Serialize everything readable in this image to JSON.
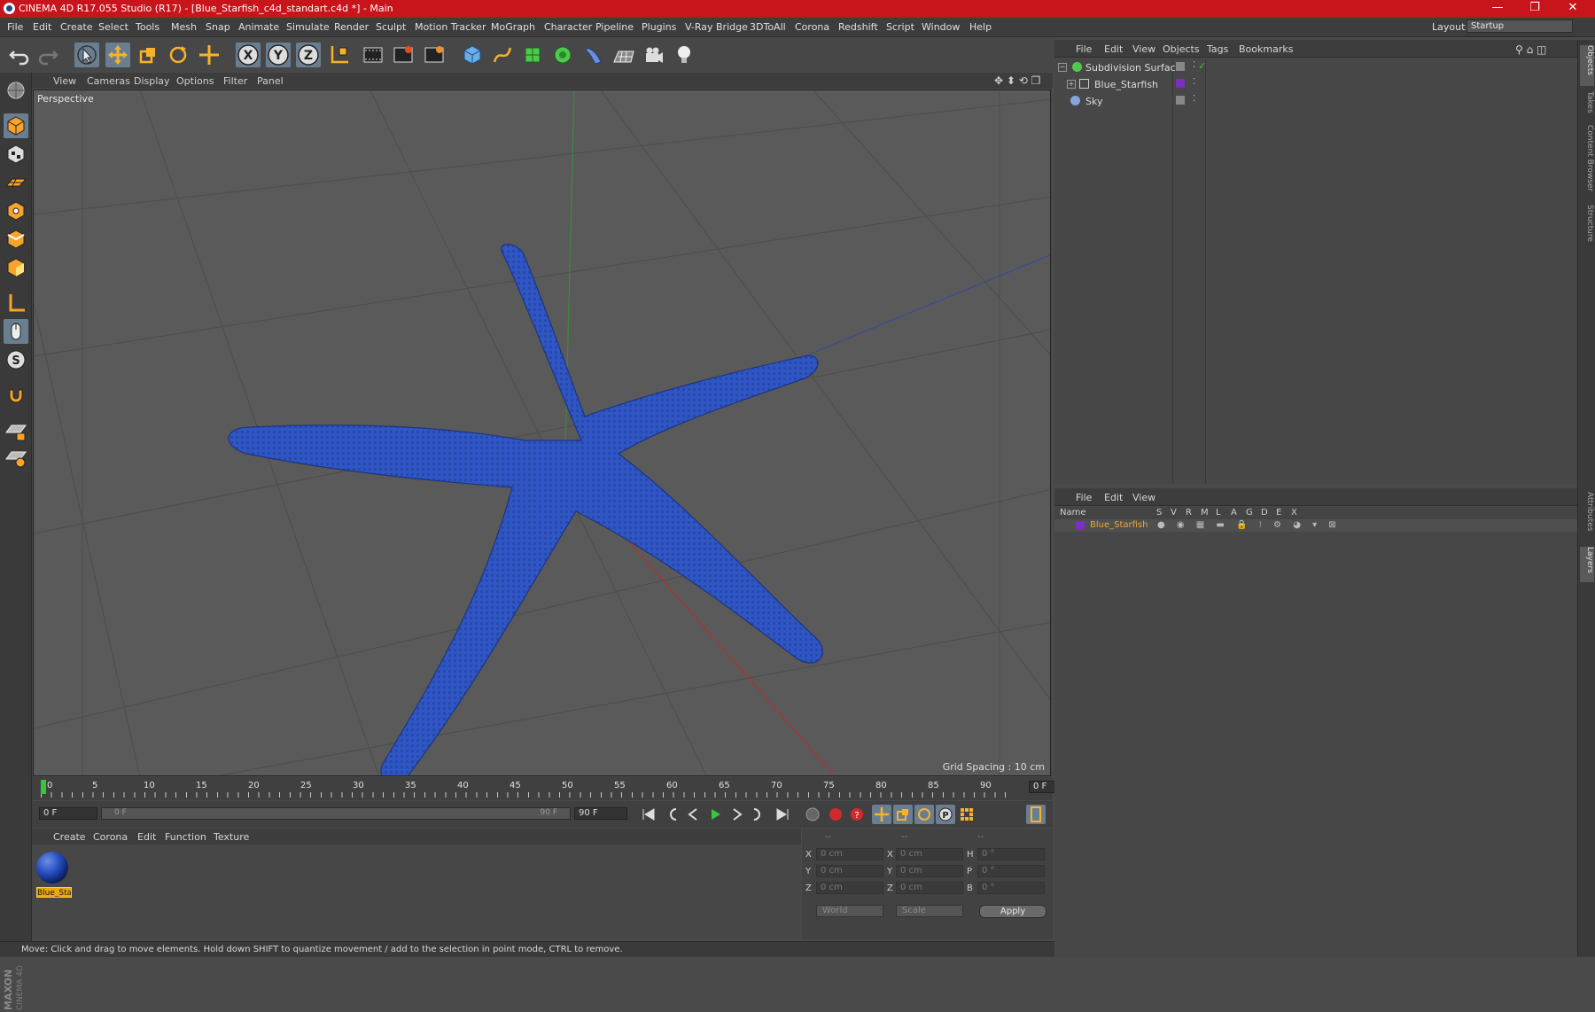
{
  "window": {
    "title": "CINEMA 4D R17.055 Studio (R17) - [Blue_Starfish_c4d_standart.c4d *] - Main",
    "controls": [
      "—",
      "❐",
      "✕"
    ]
  },
  "menubar": {
    "items": [
      "File",
      "Edit",
      "Create",
      "Select",
      "Tools",
      "Mesh",
      "Snap",
      "Animate",
      "Simulate",
      "Render",
      "Sculpt",
      "Motion Tracker",
      "MoGraph",
      "Character",
      "Pipeline",
      "Plugins",
      "V-Ray Bridge",
      "3DToAll",
      "Corona",
      "Redshift",
      "Script",
      "Window",
      "Help"
    ],
    "layout_label": "Layout:",
    "layout_value": "Startup"
  },
  "toolbar": {
    "icons": [
      "undo-icon",
      "redo-icon",
      "live-selection-icon",
      "move-icon",
      "scale-icon",
      "rotate-icon",
      "recent-tool-icon",
      "x-axis-lock-icon",
      "y-axis-lock-icon",
      "z-axis-lock-icon",
      "world-coordinate-icon",
      "render-view-icon",
      "render-picture-viewer-icon",
      "edit-render-settings-icon",
      "cube-primitive-icon",
      "pen-spline-icon",
      "subdivision-surface-icon",
      "cloner-icon",
      "deformer-icon",
      "floor-icon",
      "camera-icon",
      "light-icon"
    ],
    "x_label": "X",
    "y_label": "Y",
    "z_label": "Z"
  },
  "viewport": {
    "menu": [
      "View",
      "Cameras",
      "Display",
      "Options",
      "Filter",
      "Panel"
    ],
    "label": "Perspective",
    "grid_spacing": "Grid Spacing : 10 cm",
    "object_color": "#2f56c4"
  },
  "timeline": {
    "ticks": [
      "0",
      "5",
      "10",
      "15",
      "20",
      "25",
      "30",
      "35",
      "40",
      "45",
      "50",
      "55",
      "60",
      "65",
      "70",
      "75",
      "80",
      "85",
      "90"
    ],
    "current_frame": "0 F",
    "start_field": "0 F",
    "range_start": "0 F",
    "range_end": "90 F",
    "end_field": "90 F"
  },
  "material_manager": {
    "menu": [
      "Create",
      "Corona",
      "Edit",
      "Function",
      "Texture"
    ],
    "materials": [
      {
        "name": "Blue_Sta"
      }
    ]
  },
  "coordinates": {
    "header": [
      "--",
      "--",
      "--"
    ],
    "rows": [
      {
        "axis": "X",
        "pos": "0 cm",
        "size_axis": "X",
        "size": "0 cm",
        "rot_axis": "H",
        "rot": "0 °"
      },
      {
        "axis": "Y",
        "pos": "0 cm",
        "size_axis": "Y",
        "size": "0 cm",
        "rot_axis": "P",
        "rot": "0 °"
      },
      {
        "axis": "Z",
        "pos": "0 cm",
        "size_axis": "Z",
        "size": "0 cm",
        "rot_axis": "B",
        "rot": "0 °"
      }
    ],
    "space_dropdown": "World",
    "mode_dropdown": "Scale",
    "apply_label": "Apply"
  },
  "object_manager": {
    "menu": [
      "File",
      "Edit",
      "View",
      "Objects",
      "Tags",
      "Bookmarks"
    ],
    "objects": [
      {
        "name": "Subdivision Surface",
        "icon": "subdivision-surface-icon"
      },
      {
        "name": "Blue_Starfish",
        "icon": "polygon-object-icon"
      },
      {
        "name": "Sky",
        "icon": "sky-icon"
      }
    ]
  },
  "layer_manager": {
    "menu": [
      "File",
      "Edit",
      "View"
    ],
    "columns": [
      "Name",
      "S",
      "V",
      "R",
      "M",
      "L",
      "A",
      "G",
      "D",
      "E",
      "X"
    ],
    "layers": [
      {
        "name": "Blue_Starfish",
        "color": "#7b2fbf"
      }
    ]
  },
  "right_tabs": [
    "Objects",
    "Takes",
    "Content Browser",
    "Structure",
    "Attributes",
    "Layers"
  ],
  "status": {
    "text": "Move: Click and drag to move elements. Hold down SHIFT to quantize movement / add to the selection in point mode, CTRL to remove."
  },
  "brand": {
    "logo_text": "MAXON CINEMA 4D"
  }
}
